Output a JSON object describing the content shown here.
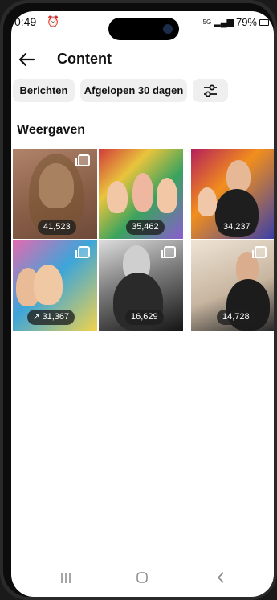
{
  "status_bar": {
    "time": "0:49",
    "network": "5G",
    "battery": "79%"
  },
  "header": {
    "title": "Content"
  },
  "filters": {
    "type_label": "Berichten",
    "period_label": "Afgelopen 30 dagen"
  },
  "section": {
    "title": "Weergaven"
  },
  "posts": [
    {
      "views": "41,523",
      "multi": true,
      "trending": false
    },
    {
      "views": "35,462",
      "multi": false,
      "trending": false
    },
    {
      "views": "34,237",
      "multi": false,
      "trending": false
    },
    {
      "views": "31,367",
      "multi": true,
      "trending": true
    },
    {
      "views": "16,629",
      "multi": true,
      "trending": false
    },
    {
      "views": "14,728",
      "multi": true,
      "trending": false
    }
  ],
  "colors": {
    "chip_bg": "#efefef",
    "text": "#111111",
    "pill_bg": "#1e1e1e"
  }
}
